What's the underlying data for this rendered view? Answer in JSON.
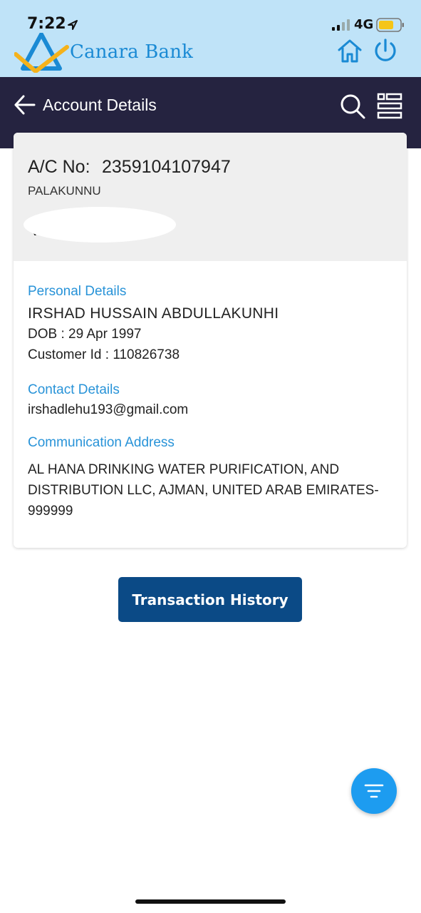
{
  "status_bar": {
    "time": "7:22",
    "network": "4G"
  },
  "brand": {
    "name": "Canara Bank"
  },
  "nav": {
    "title": "Account Details"
  },
  "account": {
    "label": "A/C No:",
    "number": "2359104107947",
    "branch": "PALAKUNNU",
    "balance_prefix": "₹"
  },
  "personal": {
    "section_title": "Personal Details",
    "name": "IRSHAD HUSSAIN ABDULLAKUNHI",
    "dob": "DOB : 29 Apr 1997",
    "customer_id": "Customer Id :  110826738"
  },
  "contact": {
    "section_title": "Contact Details",
    "email": "irshadlehu193@gmail.com"
  },
  "address": {
    "section_title": "Communication Address",
    "text": "AL HANA DRINKING WATER PURIFICATION, AND DISTRIBUTION LLC, AJMAN, UNITED ARAB EMIRATES-999999"
  },
  "actions": {
    "transaction_history": "Transaction History"
  },
  "colors": {
    "header_bg": "#bfe3f8",
    "nav_bg": "#252340",
    "accent_blue": "#2893d8",
    "button_bg": "#0b4a86",
    "fab_bg": "#1d9cf0"
  }
}
